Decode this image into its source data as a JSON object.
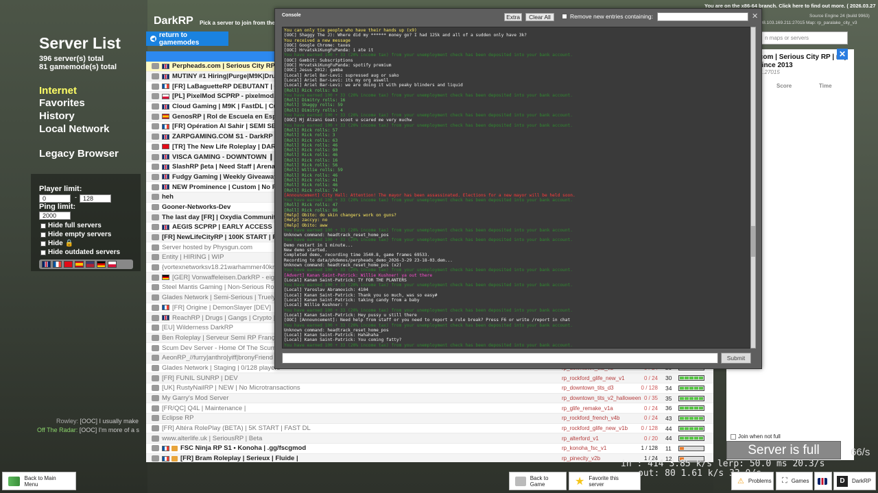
{
  "top_right": {
    "branch_notice": "You are on the x86-64 branch. Click here to find out more. ( 2026.03.27 )",
    "engine": "Source Engine 24 (build 9963)",
    "engine2": "108.103.169.211:27015 Map: rp_paralake_city_v3"
  },
  "left": {
    "title": "Server List",
    "servers_total": "396 server(s) total",
    "gamemodes_total": "81 gamemode(s) total",
    "nav": [
      "Internet",
      "Favorites",
      "History",
      "Local Network"
    ],
    "legacy": "Legacy Browser",
    "player_limit_label": "Player limit:",
    "player_min": "0",
    "player_max": "128",
    "ping_limit_label": "Ping limit:",
    "ping_value": "2000",
    "checkbox_labels": [
      "Hide full servers",
      "Hide empty servers",
      "Hide",
      "Hide outdated servers"
    ]
  },
  "header": {
    "title": "DarkRP",
    "subtitle": "Pick a server to join from the",
    "return_label": "return to gamemodes"
  },
  "servers": [
    {
      "name": "Perpheads.com | Serious City RP | F",
      "bold": true,
      "flag": "gb",
      "hl": true
    },
    {
      "name": "MUTINY #1 Hiring|Purge|M9K|Drugs|",
      "bold": true,
      "flag": "gb"
    },
    {
      "name": "[FR] LaBaguetteRP DEBUTANT | 600",
      "bold": true,
      "flag": "fr"
    },
    {
      "name": "[PL] PixelMod SCPRP - pixelmod.pl -",
      "bold": true,
      "flag": "pl"
    },
    {
      "name": "Cloud Gaming | M9K | FastDL | Cust",
      "bold": true,
      "flag": "gb"
    },
    {
      "name": "GenosRP | Rol de Escuela en Españ",
      "bold": true,
      "flag": "es"
    },
    {
      "name": "[FR] Opération Al Sahir | SEMI SERI",
      "bold": true,
      "flag": "fr"
    },
    {
      "name": "ZARPGAMING.COM S1 - DarkRP Ser",
      "bold": true,
      "flag": "gb"
    },
    {
      "name": "[TR] The New Life Roleplay | DARKR",
      "bold": true,
      "flag": "tr"
    },
    {
      "name": "VISCA GAMING - DOWNTOWN ❙ GA",
      "bold": true,
      "flag": "gb"
    },
    {
      "name": "SlashRP βeta | Need Staff | Arena | F",
      "bold": true,
      "flag": "gb"
    },
    {
      "name": "Fudgy Gaming | Weekly Giveaways |",
      "bold": true,
      "flag": "gb"
    },
    {
      "name": "NEW Prominence | Custom | No P2W",
      "bold": true,
      "flag": "gb"
    },
    {
      "name": "heh",
      "bold": true,
      "flag": ""
    },
    {
      "name": "Gooner-Networks-Dev",
      "bold": true,
      "flag": ""
    },
    {
      "name": "The last day [FR] | Oxydia Community |",
      "bold": true,
      "flag": ""
    },
    {
      "name": "AEGIS SCPRP | EARLY ACCESS",
      "bold": true,
      "flag": "gb"
    },
    {
      "name": "[FR] NewLifeCityRP | 100K START | FAM",
      "bold": true,
      "flag": ""
    },
    {
      "name": "Server hosted by Physgun.com",
      "bold": false,
      "grey": true,
      "flag": ""
    },
    {
      "name": "Entity | HIRING | WIP",
      "bold": false,
      "grey": true,
      "flag": ""
    },
    {
      "name": "{vortexnetworksv18.21warhammer40kr",
      "bold": false,
      "grey": true,
      "flag": ""
    },
    {
      "name": "[GER] Vonwaffeleisen.DarkRP - eigen",
      "bold": false,
      "grey": true,
      "flag": "de"
    },
    {
      "name": "Steel Mantis Gaming | Non-Serious Role",
      "bold": false,
      "grey": true,
      "flag": ""
    },
    {
      "name": "Glades Network | Semi-Serious | Truely",
      "bold": false,
      "grey": true,
      "flag": ""
    },
    {
      "name": "[FR] Origine | DemonSlayer [DEV]",
      "bold": false,
      "grey": true,
      "flag": "fr"
    },
    {
      "name": "ReachRP | Drugs | Gangs | Crypto |",
      "bold": false,
      "grey": true,
      "flag": "gb"
    },
    {
      "name": "[EU] Wilderness DarkRP",
      "bold": false,
      "grey": true,
      "flag": ""
    },
    {
      "name": "Ben Roleplay | Serveur Semi RP França",
      "bold": false,
      "grey": true,
      "flag": ""
    },
    {
      "name": "Scum Dev Server - Home Of The Scumb",
      "bold": false,
      "grey": true,
      "flag": ""
    },
    {
      "name": "AeonRP_//furry|anthro|yiff|bronyFriend",
      "bold": false,
      "grey": true,
      "flag": ""
    },
    {
      "name": "Glades Network | Staging | 0/128 players",
      "bold": false,
      "grey": true,
      "flag": "",
      "map": "rp_downtown_tits_v2",
      "players": "0 / 24",
      "ping": "29"
    },
    {
      "name": "[FR] FUNIL SUNRP | DEV",
      "bold": false,
      "grey": true,
      "flag": "",
      "map": "rp_rockford_glife_new_v1",
      "players": "0 / 24",
      "ping": "30"
    },
    {
      "name": "[UK] RustyNailRP | NEW | No Microtransactions",
      "bold": false,
      "grey": true,
      "flag": "",
      "map": "rp_downtown_tits_d3",
      "players": "0 / 128",
      "ping": "34"
    },
    {
      "name": "My Garry's Mod Server",
      "bold": false,
      "grey": true,
      "flag": "",
      "map": "rp_downtown_tits_v2_halloween",
      "players": "0 / 35",
      "ping": "35"
    },
    {
      "name": "[FR/QC] Q4L | Maintenance |",
      "bold": false,
      "grey": true,
      "flag": "",
      "map": "rp_glife_remake_v1a",
      "players": "0 / 24",
      "ping": "36"
    },
    {
      "name": "Eclipse RP",
      "bold": false,
      "grey": true,
      "flag": "",
      "map": "rp_rockford_french_v4b",
      "players": "0 / 24",
      "ping": "43"
    },
    {
      "name": "[FR] Altéra RolePlay (BETA) | 5K START | FAST DL",
      "bold": false,
      "grey": true,
      "flag": "",
      "map": "rp_rockford_glife_new_v1b",
      "players": "0 / 128",
      "ping": "44"
    },
    {
      "name": "www.alterlife.uk | SeriousRP | Beta",
      "bold": false,
      "grey": true,
      "flag": "",
      "map": "rp_alterford_v1",
      "players": "0 / 20",
      "ping": "44"
    },
    {
      "name": "FSC Ninja RP S1 • Konoha | .gg/fscgmod",
      "bold": true,
      "flag": "fr",
      "lock": true,
      "map": "rp_konoha_fsc_v1",
      "players": "1 / 128",
      "ping": "11",
      "warn": true
    },
    {
      "name": "[FR] Bram Roleplay | Serieux | Fluide |",
      "bold": true,
      "flag": "fr",
      "lock": true,
      "map": "rp_pinecity_v2b",
      "players": "1 / 24",
      "ping": "12",
      "warn": true
    }
  ],
  "right_panel": {
    "search_placeholder": "n maps or servers",
    "title": ".com | Serious City RP | m | Since 2013",
    "ip": "11.27015",
    "col_score": "Score",
    "col_time": "Time",
    "join_full": "Join when not full",
    "server_full": "Server is full"
  },
  "chat": {
    "line1_name": "Rowley:",
    "line1_text": "[OOC] I usually make",
    "line2_name": "Off The Radar:",
    "line2_text": "[OOC] I'm more of a s"
  },
  "netgraph": {
    "fps": "66/s",
    "line1": "in : 414   3.85 k/s lerp:  50.0 ms   20.3/s",
    "line2": "out:  80   1.61 k/s              33.0/s"
  },
  "bottom": {
    "main_menu": "Back to Main Menu",
    "back_game": "Back to Game",
    "favorite": "Favorite this server",
    "problems": "Problems",
    "games": "Games",
    "darkrp": "DarkRP"
  },
  "console": {
    "title": "Console",
    "extra": "Extra",
    "clear_all": "Clear All",
    "remove_label": "Remove new entries containing:",
    "submit": "Submit",
    "lines": [
      {
        "c": "yellow",
        "t": "You can only tie people who have their hands up (x9)"
      },
      {
        "c": "white",
        "t": "[OOC] Shaggy The J): Where did my ****** money go? I had 125k and all of a sudden only have 3k?"
      },
      {
        "c": "yellow",
        "t": "You received a new message"
      },
      {
        "c": "white",
        "t": "[OOC] Google Chrome: taxes"
      },
      {
        "c": "white",
        "t": "[OOC] HrvatskiKungFuPanda: i ate it"
      },
      {
        "c": "dkgreen",
        "t": "You have earned 100 + 33 (20% income tax) from your unemployment check has been deposited into your bank account."
      },
      {
        "c": "white",
        "t": "[OOC] Gambit: Subscriptions"
      },
      {
        "c": "white",
        "t": "[OOC] HrvatskiKungFuPanda: spotify premium"
      },
      {
        "c": "white",
        "t": "[OOC] Jesus 2012: gamba"
      },
      {
        "c": "white",
        "t": "[Local] Ariel Bar-Levi: supressed aug or sako"
      },
      {
        "c": "white",
        "t": "[Local] Ariel Bar-Levi: its my org aswell"
      },
      {
        "c": "white",
        "t": "[Local] Ariel Bar-Levi: we are doing it with peaky blinders and liquid"
      },
      {
        "c": "green",
        "t": "[Roll] Rick rolls: 63"
      },
      {
        "c": "dkgreen",
        "t": "You have earned 100 + 33 (20% income tax) from your unemployment check has been deposited into your bank account."
      },
      {
        "c": "green",
        "t": "[Roll] Dimitry rolls: 16"
      },
      {
        "c": "green",
        "t": "[Roll] Shaggy rolls: 59"
      },
      {
        "c": "green",
        "t": "[Roll] Dimitry rolls: 4"
      },
      {
        "c": "dkgreen",
        "t": "You have earned 100 + 33 (20% income tax) from your unemployment check has been deposited into your bank account."
      },
      {
        "c": "white",
        "t": "[OOC] Mj Alzani Goat: scoot u scared me very muchw"
      },
      {
        "c": "dkgreen",
        "t": "You have earned 100 + 33 (20% income tax) from your unemployment check has been deposited into your bank account."
      },
      {
        "c": "green",
        "t": "[Roll] Rick rolls: 57"
      },
      {
        "c": "green",
        "t": "[Roll] Rick rolls: 3"
      },
      {
        "c": "green",
        "t": "[Roll] Rick rolls: 63"
      },
      {
        "c": "green",
        "t": "[Roll] Rick rolls: 46"
      },
      {
        "c": "green",
        "t": "[Roll] Rick rolls: 90"
      },
      {
        "c": "green",
        "t": "[Roll] Rick rolls: 46"
      },
      {
        "c": "green",
        "t": "[Roll] Rick rolls: 16"
      },
      {
        "c": "green",
        "t": "[Roll] Rick rolls: 56"
      },
      {
        "c": "green",
        "t": "[Roll] Willie rolls: 59"
      },
      {
        "c": "green",
        "t": "[Roll] Rick rolls: 46"
      },
      {
        "c": "green",
        "t": "[Roll] Rick rolls: 41"
      },
      {
        "c": "green",
        "t": "[Roll] Rick rolls: 46"
      },
      {
        "c": "green",
        "t": "[Roll] Rick rolls: 74"
      },
      {
        "c": "red",
        "t": "[Announcement] City Hall: Attention! The mayor has been assassinated. Elections for a new mayor will be held soon."
      },
      {
        "c": "dkgreen",
        "t": "You have earned 100 + 33 (20% income tax) from your unemployment check has been deposited into your bank account."
      },
      {
        "c": "green",
        "t": "[Roll] Rick rolls: 47"
      },
      {
        "c": "green",
        "t": "[Roll] Rick rolls: 86"
      },
      {
        "c": "yellow",
        "t": "[Help] Obito: do skin changers work on guns?"
      },
      {
        "c": "yellow",
        "t": "[Help] zaccyy: no"
      },
      {
        "c": "yellow",
        "t": "[Help] Obito: aww"
      },
      {
        "c": "dkgreen",
        "t": "You have earned 100 + 33 (20% income tax) from your unemployment check has been deposited into your bank account."
      },
      {
        "c": "white",
        "t": "Unknown command: headtrack_reset_home_pos"
      },
      {
        "c": "dkgreen",
        "t": "You have earned 100 + 33 (20% income tax) from your unemployment check has been deposited into your bank account."
      },
      {
        "c": "white",
        "t": "Demo restart in 1 minute..."
      },
      {
        "c": "white",
        "t": "New demo started."
      },
      {
        "c": "white",
        "t": "Completed demo, recording time 3540.8, game frames 69533."
      },
      {
        "c": "white",
        "t": "Recording to data/phdemos/perpheads_demo_2026-3-29 23-18-03.dem..."
      },
      {
        "c": "white",
        "t": "Unknown command: headtrack_reset_home_pos (x2)"
      },
      {
        "c": "dkgreen",
        "t": "You have earned 100 + 33 (20% income tax) from your unemployment check has been deposited into your bank account."
      },
      {
        "c": "pink",
        "t": "[Advert] Kanan Saint-Patrick: Willie Kushner! ya out there"
      },
      {
        "c": "white",
        "t": "[Local] Kanan Saint-Patrick: TY FOR THE PLANTERS"
      },
      {
        "c": "dkgreen",
        "t": "You have earned 100 + 33 (20% income tax) from your unemployment check has been deposited into your bank account."
      },
      {
        "c": "white",
        "t": "[Local] Yaroslav Abramovich: 4104"
      },
      {
        "c": "white",
        "t": "[Local] Kanan Saint-Patrick: Thank you so much, was so easy#"
      },
      {
        "c": "white",
        "t": "[Local] Kanan Saint-Patrick: taking candy from a baby"
      },
      {
        "c": "white",
        "t": "[Local] Willie Kushner: ?"
      },
      {
        "c": "dkgreen",
        "t": "You have earned 100 + 33 (20% income tax) from your unemployment check has been deposited into your bank account."
      },
      {
        "c": "white",
        "t": "[Local] Kanan Saint-Patrick: Hey pussy u still there"
      },
      {
        "c": "white",
        "t": "[OOC] [Announcement]: Need help from staff or you need to report a rule break? Press F6 or write /report in chat"
      },
      {
        "c": "dkgreen",
        "t": "You have earned 100 + 33 (20% income tax) from your unemployment check has been deposited into your bank account."
      },
      {
        "c": "white",
        "t": "Unknown command: headtrack_reset_home_pos"
      },
      {
        "c": "white",
        "t": "[Local] Kanan Saint-Patrick: Hahahaha"
      },
      {
        "c": "white",
        "t": "[Local] Kanan Saint-Patrick: You coming fatty?"
      },
      {
        "c": "dkgreen",
        "t": "You have earned 100 + 33 (20% income tax) from your unemployment check has been deposited into your bank account."
      },
      {
        "c": "white",
        "t": "[OOC] Rowley: sfg??"
      }
    ]
  },
  "colors": {
    "accent_blue": "#1a82e0",
    "nav_active": "#ffff66",
    "bar_green": "#55c543",
    "bar_warn": "#e87a2a"
  }
}
